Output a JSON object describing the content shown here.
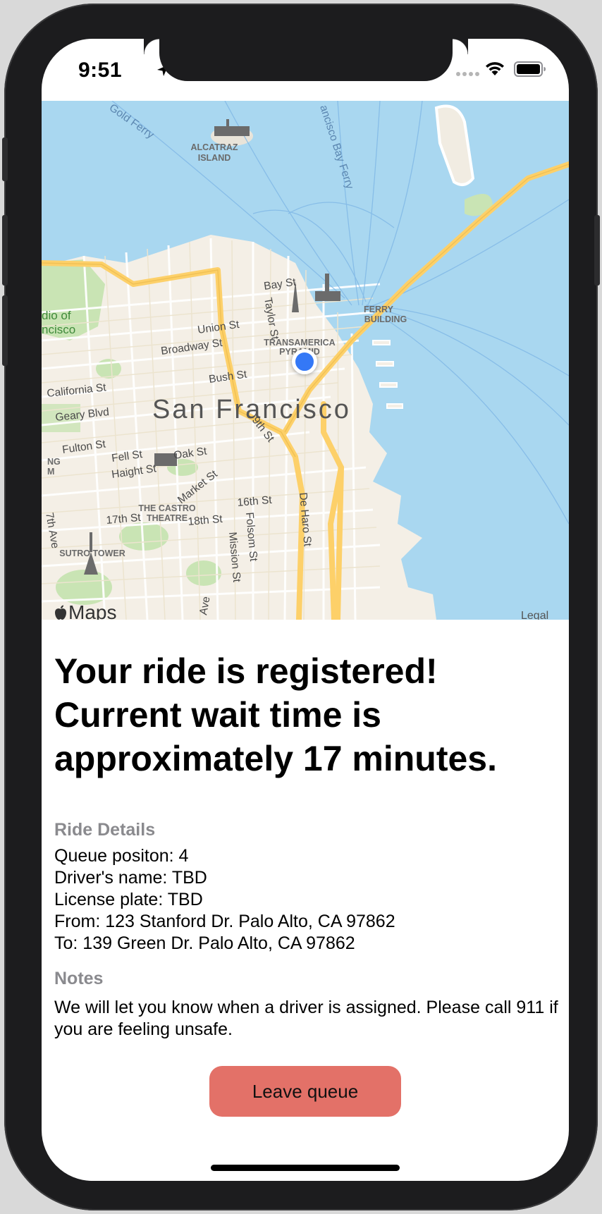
{
  "status_bar": {
    "time": "9:51",
    "icons": [
      "location-arrow-icon",
      "signal-dots-icon",
      "wifi-icon",
      "battery-icon"
    ]
  },
  "map": {
    "city_label": "San Francisco",
    "poi_labels": {
      "alcatraz_line1": "ALCATRAZ",
      "alcatraz_line2": "ISLAND",
      "ferry_line1": "FERRY",
      "ferry_line2": "BUILDING",
      "transamerica_line1": "TRANSAMERICA",
      "transamerica_line2": "PYRAMID",
      "castro_line1": "THE CASTRO",
      "castro_line2": "THEATRE",
      "sutro": "SUTRO TOWER",
      "palace_line1": "dio of",
      "palace_line2": "ncisco",
      "edge_ng": "NG",
      "edge_m": "M"
    },
    "street_labels": {
      "bay_st": "Bay St",
      "union_st": "Union St",
      "broadway_st": "Broadway St",
      "taylor_st": "Taylor St",
      "bush_st": "Bush St",
      "california_st": "California St",
      "geary_blvd": "Geary Blvd",
      "fulton_st": "Fulton St",
      "fell_st": "Fell St",
      "oak_st": "Oak St",
      "haight_st": "Haight St",
      "ninth_st": "9th St",
      "market_st": "Market St",
      "sixteenth_st": "16th St",
      "seventeenth_st": "17th St",
      "eighteenth_st": "18th St",
      "de_haro_st": "De Haro St",
      "folsom_st": "Folsom St",
      "mission_st": "Mission St",
      "seventh_ave": "7th Ave",
      "ave_edge": "Ave",
      "gold_ferry": "Gold Ferry",
      "bay_ferry": "ancisco Bay Ferry"
    },
    "brand": "Maps",
    "legal": "Legal"
  },
  "headline": "Your ride is registered! Current wait time is approximately 17 minutes.",
  "details": {
    "label": "Ride Details",
    "lines": [
      "Queue positon: 4",
      "Driver's name: TBD",
      "License plate: TBD",
      "From: 123 Stanford Dr. Palo Alto, CA 97862",
      "To: 139 Green Dr. Palo Alto, CA 97862"
    ]
  },
  "notes": {
    "label": "Notes",
    "text": "We will let you know when a driver is assigned. Please call 911 if you are feeling unsafe."
  },
  "actions": {
    "leave_queue": "Leave queue"
  },
  "colors": {
    "button": "#e37168",
    "user_location": "#3478f6",
    "water": "#a9d7f0",
    "land": "#f4efe6",
    "highway": "#fdd069",
    "park": "#c9e4b4"
  }
}
